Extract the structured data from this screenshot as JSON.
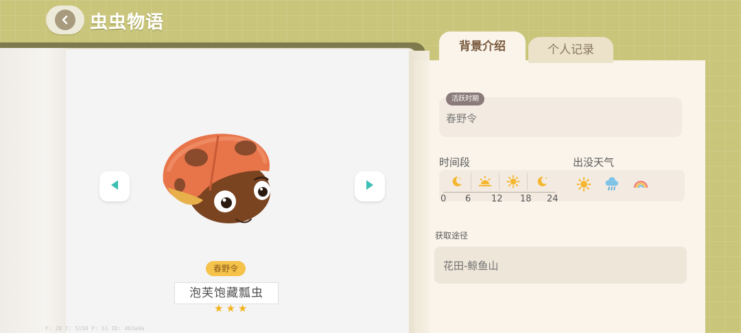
{
  "header": {
    "title": "虫虫物语"
  },
  "tabs": [
    {
      "label": "背景介绍",
      "active": true
    },
    {
      "label": "个人记录",
      "active": false
    }
  ],
  "bug": {
    "name": "泡芙饱藏瓢虫",
    "season": "春野令",
    "rarity_stars": 3,
    "stars": [
      "★",
      "★",
      "★"
    ]
  },
  "details": {
    "active_period_tag": "活跃时期",
    "active_period_value": "春野令",
    "time_label": "时间段",
    "time_icons": [
      "moon-icon",
      "sunrise-icon",
      "sun-icon",
      "moon-icon"
    ],
    "time_ticks": [
      "0",
      "6",
      "12",
      "18",
      "24"
    ],
    "weather_label": "出没天气",
    "weather_icons": [
      "sun-icon",
      "rain-cloud-icon",
      "rainbow-icon"
    ],
    "source_label": "获取途径",
    "source_value": "花田-鲸鱼山"
  },
  "debug_text": "F: 28   T: 5150   P: 51   ID: 4b3a9a",
  "colors": {
    "background": "#c9c57a",
    "panel": "#faf4ea",
    "star": "#f2b21c",
    "season_badge": "#f5c24a",
    "arrow": "#3cbfb3"
  }
}
